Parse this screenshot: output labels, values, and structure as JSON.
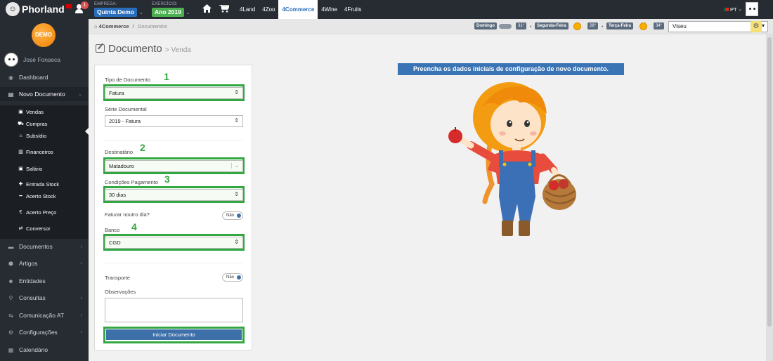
{
  "app": {
    "logo_text": "Phorland"
  },
  "topbar": {
    "notifications": "1",
    "empresa_label": "EMPRESA:",
    "empresa_value": "Quinta Demo",
    "exercicio_label": "EXERCÍCIO:",
    "exercicio_value": "Ano 2019",
    "nav": [
      "4Land",
      "4Zoo",
      "4Commerce",
      "4Wine",
      "4Fruits"
    ],
    "active_nav": "4Commerce",
    "language": "PT"
  },
  "sidebar": {
    "demo_badge": "DEMO",
    "user_name": "José Fonseca",
    "items": [
      {
        "label": "Dashboard",
        "icon": "palette-icon"
      },
      {
        "label": "Novo Documento",
        "icon": "file-icon"
      },
      {
        "label": "Documentos",
        "icon": "folder-icon"
      },
      {
        "label": "Artigos",
        "icon": "cubes-icon"
      },
      {
        "label": "Entidades",
        "icon": "users-icon"
      },
      {
        "label": "Consultas",
        "icon": "search-icon"
      },
      {
        "label": "Comunicação AT",
        "icon": "exchange-icon"
      },
      {
        "label": "Configurações",
        "icon": "cogs-icon"
      },
      {
        "label": "Calendário",
        "icon": "calendar-icon"
      }
    ],
    "sub_items": [
      {
        "label": "Vendas",
        "icon": "money-icon"
      },
      {
        "label": "Compras",
        "icon": "cart-icon"
      },
      {
        "label": "Subsídio",
        "icon": "bank-icon"
      },
      {
        "label": "Financeiros",
        "icon": "file-text-icon"
      },
      {
        "label": "Salário",
        "icon": "money-icon"
      },
      {
        "label": "Entrada Stock",
        "icon": "plus-icon"
      },
      {
        "label": "Acerto Stock",
        "icon": "minus-icon"
      },
      {
        "label": "Acerto Preço",
        "icon": "euro-icon"
      },
      {
        "label": "Conversor",
        "icon": "conversor-icon"
      }
    ]
  },
  "breadcrumb": {
    "root": "4Commerce",
    "sep": "/",
    "current": "Documentos"
  },
  "weather": {
    "days": [
      {
        "day": "Domingo",
        "temp": "31°"
      },
      {
        "day": "Segunda-Feira",
        "temp": "28°"
      },
      {
        "day": "Terça-Feira",
        "temp": "34°"
      }
    ],
    "city": "Viseu"
  },
  "page": {
    "title": "Documento",
    "subtitle": "> Venda"
  },
  "form": {
    "tipo_label": "Tipo de Documento",
    "tipo_value": "Fatura",
    "serie_label": "Série Documental",
    "serie_value": "2019 - Fatura",
    "destinatario_label": "Destinatário",
    "destinatario_value": "Matadouro",
    "condicoes_label": "Condições Pagamento",
    "condicoes_value": "30 dias",
    "faturar_label": "Faturar noutro dia?",
    "faturar_toggle": "Não",
    "banco_label": "Banco",
    "banco_value": "CGD",
    "transporte_label": "Transporte",
    "transporte_toggle": "Não",
    "observacoes_label": "Observações",
    "submit_label": "Iniciar Documento",
    "steps": [
      "1",
      "2",
      "3",
      "4"
    ]
  },
  "main": {
    "banner": "Preencha os dados iniciais de configuração de novo documento."
  },
  "colors": {
    "accent": "#3a74b4",
    "highlight": "#33a842",
    "sidebar": "#272c33",
    "empresa": "#2a6ebb",
    "exercicio": "#4caf50"
  }
}
